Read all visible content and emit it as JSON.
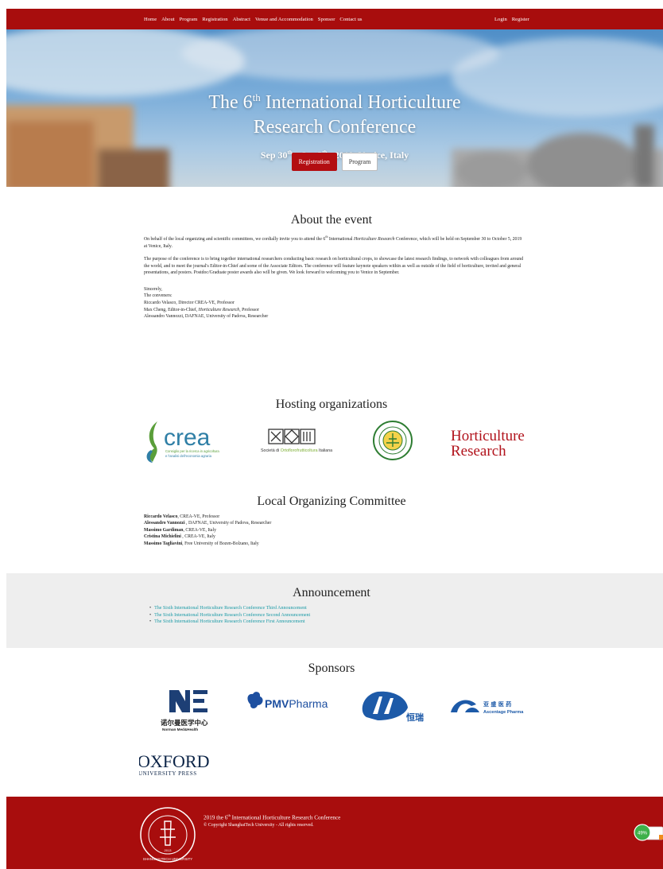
{
  "nav": {
    "left": [
      "Home",
      "About",
      "Program",
      "Registration",
      "Abstract",
      "Venue and Accommodation",
      "Sponsor",
      "Contact us"
    ],
    "right": [
      "Login",
      "Register"
    ]
  },
  "hero": {
    "title_pre": "The 6",
    "title_sup": "th",
    "title_post": " International Horticulture",
    "title_line2": "Research Conference",
    "date_a": "Sep 30",
    "date_a_sup": "th",
    "date_mid": " - Oct 5",
    "date_b_sup": "th",
    "date_end": " , 2019",
    "place": "Venice, Italy",
    "btn_registration": "Registration",
    "btn_program": "Program"
  },
  "about": {
    "title": "About the event",
    "p1_a": "On behalf of the local organizing and scientific committees, we cordially invite you to attend the 6",
    "p1_sup": "th",
    "p1_b": " International ",
    "p1_em": "Horticulture Research",
    "p1_c": " Conference, which will be held on September 30 to October 5, 2019 at Venice, Italy.",
    "p2": "The purpose of the conference is to bring together international researchers conducting basic research on horticultural crops, to showcase the latest research findings, to network with colleagues from around the world, and to meet the journal's Editor-in-Chief and some of the Associate Editors. The conference will feature keynote speakers within as well as outside of the field of horticulture, invited and general presentations, and posters. Postdoc/Graduate poster awards also will be given. We look forward to welcoming you to Venice in September.",
    "sincerely": "Sincerely,",
    "conveners": "The conveners:",
    "c1": "Riccardo Velasco, Director CREA-VE, Professor",
    "c2_a": "Max Cheng, Editor-in-Chief, ",
    "c2_em": "Horticulture Research",
    "c2_b": ", Professor",
    "c3": "Alessandro Vannozzi, DAFNAE, University of Padova, Researcher"
  },
  "hosting": {
    "title": "Hosting organizations",
    "crea_word": "crea",
    "crea_tag1": "Consiglio per la ricerca in agricoltura",
    "crea_tag2": "e l'analisi dell'economia agraria",
    "soi_a": "Società di ",
    "soi_b": "Ortoflorofrutticoltura",
    "soi_c": " Italiana",
    "hr_1": "Horticulture",
    "hr_2": "Research"
  },
  "committee": {
    "title": "Local Organizing Committee",
    "members": [
      {
        "name": "Riccardo Velasco",
        "affil": ", CREA-VE, Professor"
      },
      {
        "name": "Alessandro Vannozzi",
        "affil": " , DAFNAE, University of Padova, Researcher"
      },
      {
        "name": "Massimo Gardiman",
        "affil": ", CREA-VE, Italy"
      },
      {
        "name": "Cristina Michielini",
        "affil": " , CREA-VE, Italy"
      },
      {
        "name": "Massimo Tagliavini",
        "affil": ", Free University of Bozen-Bolzano, Italy"
      }
    ]
  },
  "announcement": {
    "title": "Announcement",
    "items": [
      "The Sixth International Horticulture Research Conference Third Announcement",
      "The Sixth International Horticulture Research Conference Second Announcement",
      "The Sixth International Horticulture Research Conference First Announcement"
    ]
  },
  "sponsors": {
    "title": "Sponsors",
    "norman_cn": "诺尔曼医学中心",
    "norman_en": "Norman Med&Health",
    "pmv_a": "PMV",
    "pmv_b": "Pharma",
    "hengrui_cn": "恒瑞",
    "asc_cn": "亚 盛 医 药",
    "asc_en": "Ascentage Pharma",
    "oxford_1": "OXFORD",
    "oxford_2": "UNIVERSITY PRESS"
  },
  "footer": {
    "line1_a": "2019 the 6",
    "line1_sup": "th",
    "line1_b": " International Horticulture Research Conference",
    "line2": "© Copyright ShanghaiTech University - All rights reserved.",
    "seal_text": "SHANGHAITECH UNIVERSITY",
    "seal_year": "2013"
  },
  "widget": {
    "label": "49%"
  },
  "colors": {
    "brand_red": "#a80d0d",
    "link_teal": "#1a9aa6",
    "crea_green": "#5a9e3a",
    "oxford_navy": "#0b2346"
  }
}
